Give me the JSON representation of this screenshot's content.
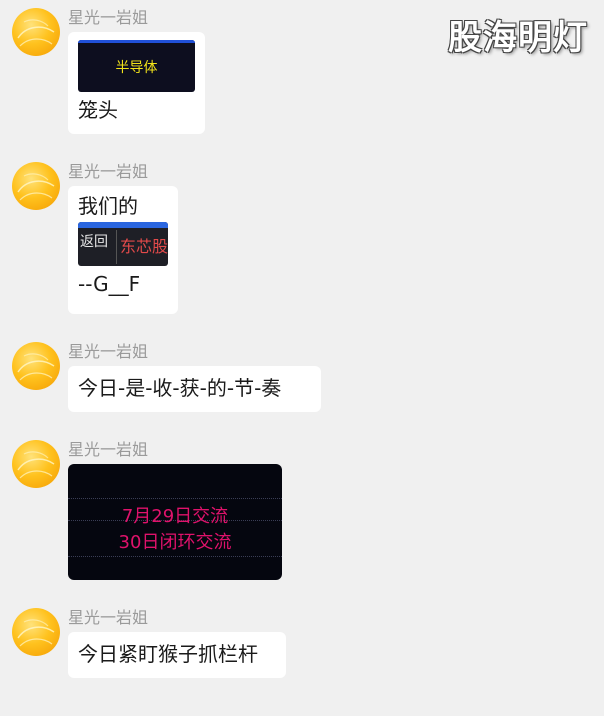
{
  "watermark": "股海明灯",
  "messages": [
    {
      "sender": "星光一岩姐",
      "image": {
        "text": "半导体"
      },
      "text": "笼头"
    },
    {
      "sender": "星光一岩姐",
      "text_before": "我们的",
      "image": {
        "back_label": "返回",
        "stock_label": "东芯股"
      },
      "text_after": "--G__F"
    },
    {
      "sender": "星光一岩姐",
      "text": "今日-是-收-获-的-节-奏"
    },
    {
      "sender": "星光一岩姐",
      "image": {
        "line1": "7月29日交流",
        "line2": "30日闭环交流"
      }
    },
    {
      "sender": "星光一岩姐",
      "text": "今日紧盯猴子抓栏杆"
    }
  ],
  "colors": {
    "background": "#f0f0f0",
    "bubble": "#ffffff",
    "sender_name": "#9a9a9a",
    "dark_card_text": "#e0126b",
    "thumb_text_yellow": "#f2e31a",
    "stock_red": "#e24a4a"
  },
  "icons": {
    "avatar": "avatar-icon"
  }
}
